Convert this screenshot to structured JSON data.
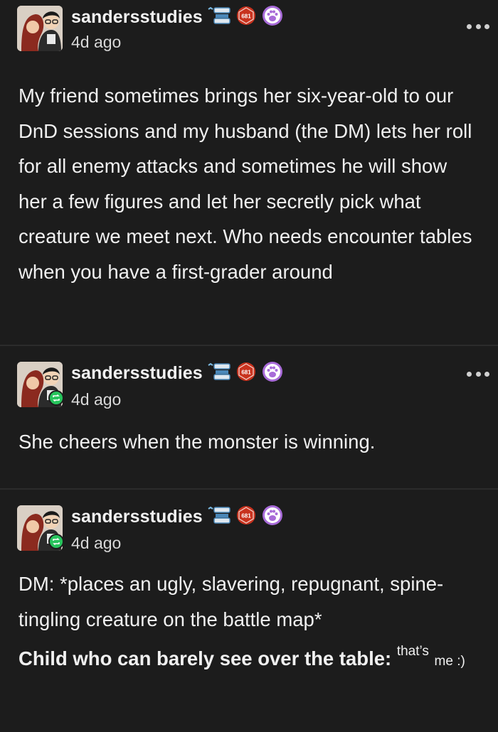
{
  "posts": [
    {
      "username": "sandersstudies",
      "time": "4d ago",
      "reblogged": false,
      "text": "My friend sometimes brings her six-year-old to our DnD sessions and my husband (the DM) lets her roll for all enemy attacks and sometimes he will show her a few figures and let her secretly pick what creature we meet next. Who needs encounter tables when you have a first-grader around"
    },
    {
      "username": "sandersstudies",
      "time": "4d ago",
      "reblogged": true,
      "text": "She cheers when the monster is winning."
    },
    {
      "username": "sandersstudies",
      "time": "4d ago",
      "reblogged": true,
      "dm_label": "DM:",
      "dm_text": " *places an ugly, slavering, repugnant, spine-tingling creature on the battle map*",
      "child_label": "Child who can barely see over the table:",
      "child_sup": "that’s",
      "child_small": "me :)"
    }
  ],
  "badges": {
    "first": "scroll-badge-icon",
    "second": "d20-badge-icon",
    "second_text": "681",
    "third": "paw-badge-icon"
  },
  "colors": {
    "background": "#1c1c1c",
    "text": "#f0f0f0",
    "reblog_green": "#27c45c",
    "badge_red": "#c8321e",
    "paw_purple": "#a86bd8"
  }
}
